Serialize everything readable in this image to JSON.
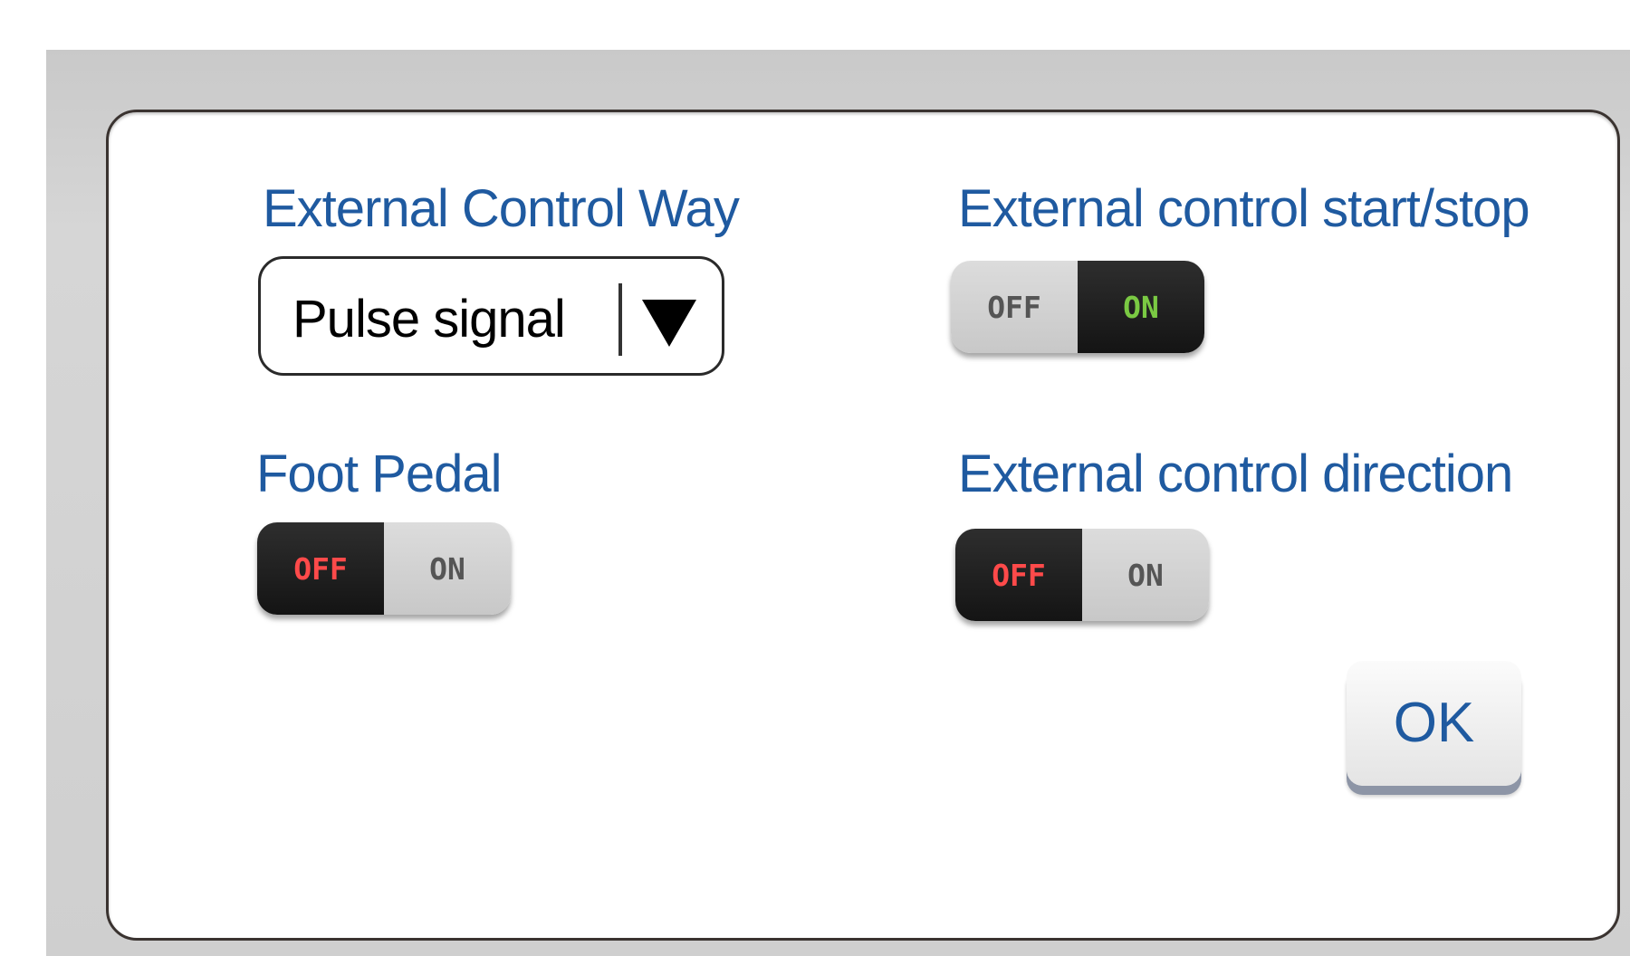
{
  "dialog": {
    "control_way": {
      "label": "External Control Way",
      "selected_value": "Pulse signal"
    },
    "start_stop": {
      "label": "External control start/stop",
      "off_label": "OFF",
      "on_label": "ON",
      "state": "ON"
    },
    "foot_pedal": {
      "label": "Foot Pedal",
      "off_label": "OFF",
      "on_label": "ON",
      "state": "OFF"
    },
    "direction": {
      "label": "External control direction",
      "off_label": "OFF",
      "on_label": "ON",
      "state": "OFF"
    },
    "ok_label": "OK"
  },
  "colors": {
    "label_blue": "#1f5aa0",
    "on_green": "#7ac943",
    "off_red": "#ff4a4a",
    "toggle_dark": "#1e1e1e",
    "toggle_light": "#d2d2d2"
  },
  "icons": {
    "dropdown": "triangle-down-icon"
  }
}
